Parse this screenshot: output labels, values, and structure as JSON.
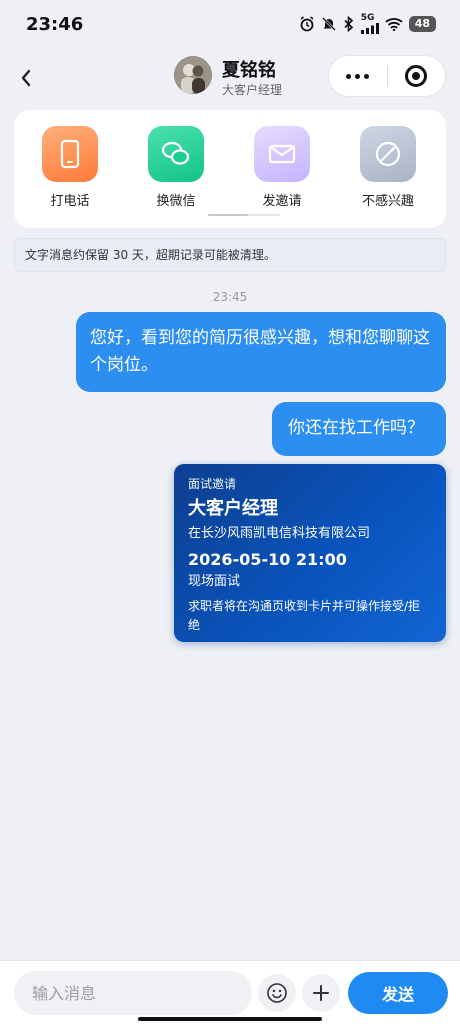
{
  "status_bar": {
    "time": "23:46",
    "network": "5G",
    "battery": "48"
  },
  "header": {
    "back_icon": "chevron-left-icon",
    "name": "夏铭铭",
    "title": "大客户经理"
  },
  "actions": [
    {
      "label": "打电话",
      "icon": "phone-icon"
    },
    {
      "label": "换微信",
      "icon": "wechat-icon"
    },
    {
      "label": "发邀请",
      "icon": "mail-icon"
    },
    {
      "label": "不感兴趣",
      "icon": "block-icon"
    }
  ],
  "notice": "文字消息约保留 30 天，超期记录可能被清理。",
  "timestamp": "23:45",
  "messages": [
    {
      "text": "您好，看到您的简历很感兴趣，想和您聊聊这个岗位。"
    },
    {
      "text": "你还在找工作吗？"
    }
  ],
  "invite_card": {
    "tag": "面试邀请",
    "job": "大客户经理",
    "company": "在长沙风雨凯电信科技有限公司",
    "time": "2026-05-10 21:00",
    "type": "现场面试",
    "note": "求职者将在沟通页收到卡片并可操作接受/拒绝"
  },
  "composer": {
    "placeholder": "输入消息",
    "send_label": "发送"
  },
  "colors": {
    "accent": "#2b8ef0",
    "invite_card": "#0a55bf",
    "background": "#eef0f5"
  }
}
